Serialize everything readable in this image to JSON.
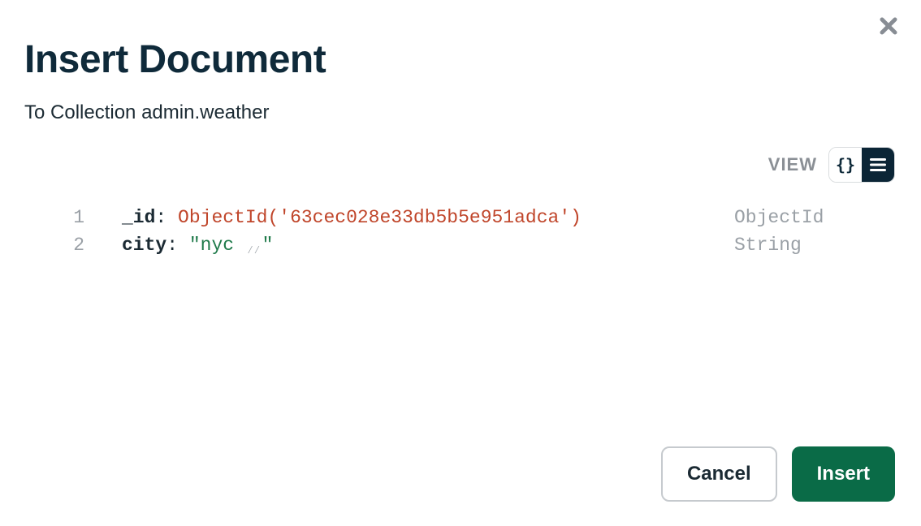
{
  "modal": {
    "title": "Insert Document",
    "subtitle": "To Collection admin.weather",
    "view_label": "VIEW"
  },
  "editor": {
    "lines": [
      {
        "num": "1",
        "key": "_id",
        "value_prefix": "ObjectId('",
        "value_core": "63cec028e33db5b5e951adca",
        "value_suffix": "')",
        "type": "ObjectId"
      },
      {
        "num": "2",
        "key": "city",
        "string_open": "\"",
        "string_body": "nyc ",
        "string_close": "\"",
        "type": "String"
      }
    ]
  },
  "footer": {
    "cancel": "Cancel",
    "insert": "Insert"
  },
  "icons": {
    "json": "{}"
  }
}
